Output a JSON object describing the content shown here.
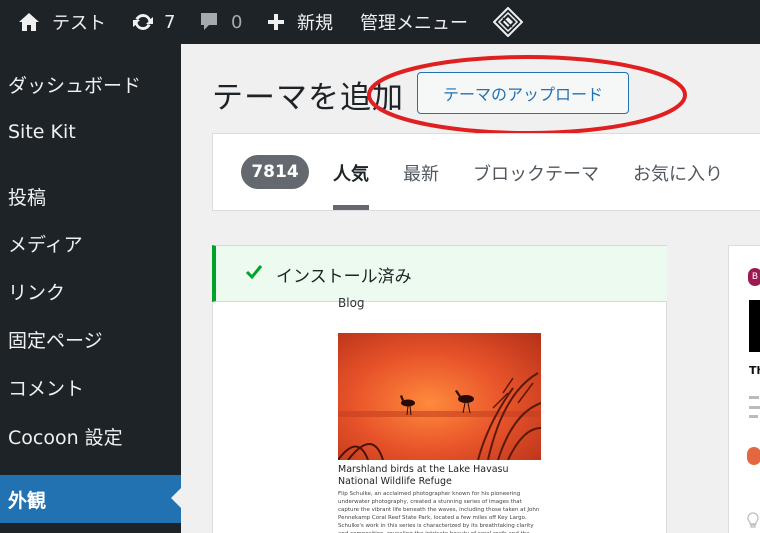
{
  "adminbar": {
    "site_name": "テスト",
    "updates_count": "7",
    "comments_count": "0",
    "new_label": "新規",
    "admin_menu_label": "管理メニュー"
  },
  "sidebar": {
    "items": [
      {
        "label": "ダッシュボード"
      },
      {
        "label": "Site Kit"
      },
      {
        "label": "投稿"
      },
      {
        "label": "メディア"
      },
      {
        "label": "リンク"
      },
      {
        "label": "固定ページ"
      },
      {
        "label": "コメント"
      },
      {
        "label": "Cocoon 設定"
      },
      {
        "label": "外観"
      }
    ]
  },
  "main": {
    "title": "テーマを追加",
    "upload_button": "テーマのアップロード",
    "theme_count": "7814",
    "tabs": [
      {
        "label": "人気"
      },
      {
        "label": "最新"
      },
      {
        "label": "ブロックテーマ"
      },
      {
        "label": "お気に入り"
      }
    ],
    "installed_notice": "インストール済み",
    "preview": {
      "blog_label": "Blog",
      "caption": "Marshland birds at the Lake Havasu National Wildlife Refuge",
      "body": "Flip Schulke, an acclaimed photographer known for his pioneering underwater photography, created a stunning series of images that capture the vibrant life beneath the waves, including those taken at John Pennekamp Coral Reef State Park, located a few miles off Key Largo. Schulke's work in this series is characterized by its breathtaking clarity and composition, revealing the intricate beauty of coral reefs and the diverse marine life that inhabits them."
    },
    "card2": {
      "logo_letter": "B",
      "heading_fragment": "Th"
    }
  },
  "colors": {
    "adminbar_bg": "#1d2327",
    "accent": "#2271b1",
    "success": "#00a32a",
    "highlight_ellipse": "#e02020"
  }
}
